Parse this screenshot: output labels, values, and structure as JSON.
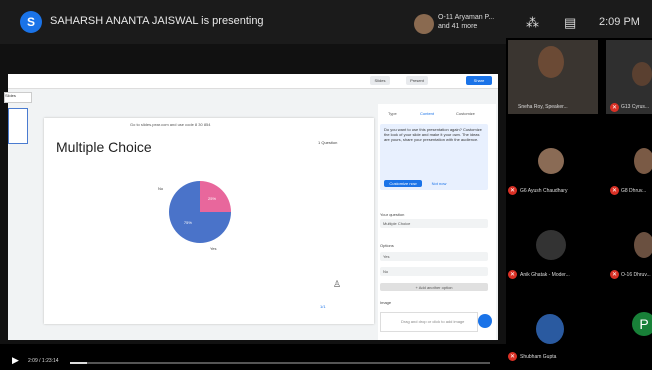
{
  "meeting": {
    "presenter_initial": "S",
    "presenting_text": "SAHARSH ANANTA JAISWAL is presenting",
    "others_line1": "O-11 Aryaman P...",
    "others_line2": "and 41 more",
    "clock": "2:09 PM",
    "status_icons": [
      "grid-icon",
      "caption-icon"
    ]
  },
  "slides_app": {
    "toolbar_buttons": [
      "Slides",
      "Present",
      "Share"
    ],
    "left_tab": "Slides",
    "slide_url": "Go to slides.pear.com and use code 8 30 854",
    "slide_title": "Multiple Choice",
    "slide_tag": "1 Question",
    "page_indicator": "1/1"
  },
  "side_panel": {
    "tabs": [
      "Type",
      "Content",
      "Customize"
    ],
    "info_text": "Do you want to use this presentation again? Customize the look of your slide and make it your own. The ideas are yours, share your presentation with the audience.",
    "info_buttons": [
      "Customize now",
      "Not now"
    ],
    "question_label": "Your question",
    "question_value": "Multiple Choice",
    "options_label": "Options",
    "options": [
      "Yes",
      "No"
    ],
    "add_answer": "+ Add another option",
    "image_label": "Image",
    "image_hint": "Drag and drop or click to add image"
  },
  "chart_data": {
    "type": "pie",
    "values": [
      75,
      25
    ],
    "labels": [
      "75%",
      "25%"
    ],
    "legend": [
      "Yes",
      "No"
    ],
    "colors": [
      "#4a73c9",
      "#e8679c"
    ]
  },
  "player": {
    "timecode": "2:09 / 1:23:14",
    "progress": 0.04
  },
  "participants": [
    {
      "name": "Sneha Roy, Speaker...",
      "type": "video"
    },
    {
      "name": "G13 Cyrus...",
      "type": "video"
    },
    {
      "name": "G6 Ayush Chaudhary",
      "type": "avatar"
    },
    {
      "name": "G8 Dhruv...",
      "type": "avatar"
    },
    {
      "name": "Anik Ghatak - Moder...",
      "type": "avatar"
    },
    {
      "name": "O-16 Dhruv...",
      "type": "avatar"
    },
    {
      "name": "Shubham Gupta",
      "type": "avatar"
    },
    {
      "name": "P",
      "type": "letter"
    }
  ],
  "colors": {
    "accent": "#1a73e8",
    "mic_off": "#d93025",
    "pie_blue": "#4a73c9",
    "pie_pink": "#e8679c"
  }
}
